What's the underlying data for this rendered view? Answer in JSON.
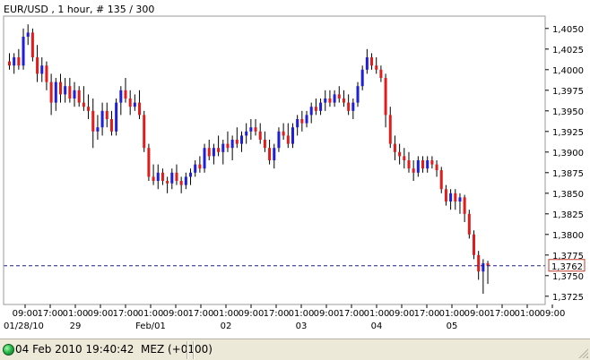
{
  "window": {
    "title": "EUR/USD , 1 hour, # 135 / 300"
  },
  "status": {
    "text": "04 Feb 2010 19:40:42  MEZ (+0100)"
  },
  "colors": {
    "up": "#1f1fd6",
    "down": "#e01d1d",
    "wick": "#000000",
    "current_line": "#1f1f8a",
    "current_box": "#c0392b"
  },
  "chart_data": {
    "type": "candlestick",
    "title": "EUR/USD , 1 hour, # 135 / 300",
    "instrument": "EUR/USD",
    "interval": "1 hour",
    "ylim": [
      1.3715,
      1.4065
    ],
    "y_ticks": [
      "1,4050",
      "1,4025",
      "1,4000",
      "1,3975",
      "1,3950",
      "1,3925",
      "1,3900",
      "1,3875",
      "1,3850",
      "1,3825",
      "1,3800",
      "1,3775",
      "1,3750",
      "1,3725"
    ],
    "y_tick_values": [
      1.405,
      1.4025,
      1.4,
      1.3975,
      1.395,
      1.3925,
      1.39,
      1.3875,
      1.385,
      1.3825,
      1.38,
      1.3775,
      1.375,
      1.3725
    ],
    "current_price": 1.3762,
    "current_price_label": "1,3762",
    "x_time_ticks": [
      "09:00",
      "17:00",
      "01:00",
      "09:00",
      "17:00",
      "01:00",
      "09:00",
      "17:00",
      "01:00",
      "09:00",
      "17:00",
      "01:00",
      "09:00",
      "17:00",
      "01:00",
      "09:00",
      "17:00",
      "01:00",
      "09:00",
      "17:00",
      "01:00",
      "09:00"
    ],
    "x_date_ticks": [
      {
        "label": "01/28/10",
        "tick_index": 0
      },
      {
        "label": "29",
        "tick_index": 2
      },
      {
        "label": "Feb/01",
        "tick_index": 5
      },
      {
        "label": "02",
        "tick_index": 8
      },
      {
        "label": "03",
        "tick_index": 11
      },
      {
        "label": "04",
        "tick_index": 14
      },
      {
        "label": "05",
        "tick_index": 17
      }
    ],
    "candles": [
      [
        1.401,
        1.402,
        1.4,
        1.4005
      ],
      [
        1.4005,
        1.402,
        1.3995,
        1.4015
      ],
      [
        1.4015,
        1.4025,
        1.4,
        1.4005
      ],
      [
        1.4005,
        1.405,
        1.4,
        1.404
      ],
      [
        1.404,
        1.4055,
        1.403,
        1.4045
      ],
      [
        1.4045,
        1.405,
        1.401,
        1.4015
      ],
      [
        1.4015,
        1.403,
        1.3985,
        1.3995
      ],
      [
        1.3995,
        1.4015,
        1.3985,
        1.4005
      ],
      [
        1.4005,
        1.401,
        1.3975,
        1.3985
      ],
      [
        1.3985,
        1.3995,
        1.3945,
        1.396
      ],
      [
        1.396,
        1.399,
        1.395,
        1.3985
      ],
      [
        1.3985,
        1.3995,
        1.396,
        1.397
      ],
      [
        1.397,
        1.399,
        1.396,
        1.398
      ],
      [
        1.398,
        1.399,
        1.396,
        1.3965
      ],
      [
        1.3965,
        1.3985,
        1.3955,
        1.3975
      ],
      [
        1.3975,
        1.398,
        1.3955,
        1.396
      ],
      [
        1.396,
        1.398,
        1.395,
        1.3955
      ],
      [
        1.3955,
        1.397,
        1.394,
        1.395
      ],
      [
        1.395,
        1.3965,
        1.3905,
        1.3925
      ],
      [
        1.3925,
        1.3945,
        1.3915,
        1.393
      ],
      [
        1.393,
        1.396,
        1.392,
        1.395
      ],
      [
        1.395,
        1.396,
        1.393,
        1.394
      ],
      [
        1.394,
        1.395,
        1.392,
        1.3925
      ],
      [
        1.3925,
        1.3965,
        1.392,
        1.396
      ],
      [
        1.396,
        1.398,
        1.3945,
        1.3975
      ],
      [
        1.3975,
        1.399,
        1.396,
        1.3965
      ],
      [
        1.3965,
        1.3975,
        1.3945,
        1.3955
      ],
      [
        1.3955,
        1.397,
        1.395,
        1.396
      ],
      [
        1.396,
        1.3975,
        1.394,
        1.3945
      ],
      [
        1.3945,
        1.395,
        1.39,
        1.3905
      ],
      [
        1.3905,
        1.391,
        1.3865,
        1.387
      ],
      [
        1.387,
        1.3885,
        1.386,
        1.3865
      ],
      [
        1.3865,
        1.3885,
        1.3855,
        1.3875
      ],
      [
        1.3875,
        1.388,
        1.386,
        1.3865
      ],
      [
        1.3865,
        1.387,
        1.385,
        1.3862
      ],
      [
        1.3862,
        1.388,
        1.3855,
        1.3875
      ],
      [
        1.3875,
        1.3885,
        1.386,
        1.3865
      ],
      [
        1.3865,
        1.387,
        1.385,
        1.386
      ],
      [
        1.386,
        1.3875,
        1.3855,
        1.387
      ],
      [
        1.387,
        1.388,
        1.386,
        1.3875
      ],
      [
        1.3875,
        1.389,
        1.387,
        1.3885
      ],
      [
        1.3885,
        1.3895,
        1.3875,
        1.388
      ],
      [
        1.388,
        1.391,
        1.3875,
        1.3905
      ],
      [
        1.3905,
        1.3915,
        1.389,
        1.3895
      ],
      [
        1.3895,
        1.391,
        1.3885,
        1.3905
      ],
      [
        1.3905,
        1.392,
        1.3895,
        1.39
      ],
      [
        1.39,
        1.3915,
        1.3885,
        1.391
      ],
      [
        1.391,
        1.3925,
        1.39,
        1.3905
      ],
      [
        1.3905,
        1.392,
        1.389,
        1.3915
      ],
      [
        1.3915,
        1.393,
        1.3905,
        1.391
      ],
      [
        1.391,
        1.3925,
        1.39,
        1.392
      ],
      [
        1.392,
        1.3935,
        1.391,
        1.3925
      ],
      [
        1.3925,
        1.394,
        1.3915,
        1.393
      ],
      [
        1.393,
        1.394,
        1.392,
        1.3925
      ],
      [
        1.3925,
        1.3935,
        1.391,
        1.3915
      ],
      [
        1.3915,
        1.3925,
        1.39,
        1.3905
      ],
      [
        1.3905,
        1.3915,
        1.3885,
        1.389
      ],
      [
        1.389,
        1.391,
        1.388,
        1.3905
      ],
      [
        1.3905,
        1.393,
        1.39,
        1.3925
      ],
      [
        1.3925,
        1.3935,
        1.3915,
        1.392
      ],
      [
        1.392,
        1.3935,
        1.3905,
        1.391
      ],
      [
        1.391,
        1.3935,
        1.3905,
        1.393
      ],
      [
        1.393,
        1.3945,
        1.392,
        1.394
      ],
      [
        1.394,
        1.395,
        1.3925,
        1.3935
      ],
      [
        1.3935,
        1.395,
        1.393,
        1.3945
      ],
      [
        1.3945,
        1.396,
        1.3935,
        1.3955
      ],
      [
        1.3955,
        1.3965,
        1.3945,
        1.395
      ],
      [
        1.395,
        1.3965,
        1.3945,
        1.396
      ],
      [
        1.396,
        1.3975,
        1.395,
        1.3965
      ],
      [
        1.3965,
        1.3975,
        1.3955,
        1.396
      ],
      [
        1.396,
        1.3975,
        1.3955,
        1.397
      ],
      [
        1.397,
        1.398,
        1.396,
        1.3965
      ],
      [
        1.3965,
        1.3975,
        1.3955,
        1.396
      ],
      [
        1.396,
        1.397,
        1.3945,
        1.395
      ],
      [
        1.395,
        1.3965,
        1.394,
        1.396
      ],
      [
        1.396,
        1.3985,
        1.3955,
        1.398
      ],
      [
        1.398,
        1.4005,
        1.3975,
        1.4
      ],
      [
        1.4,
        1.4025,
        1.3995,
        1.4015
      ],
      [
        1.4015,
        1.402,
        1.4,
        1.4005
      ],
      [
        1.4005,
        1.4015,
        1.3995,
        1.4
      ],
      [
        1.4,
        1.4005,
        1.3985,
        1.399
      ],
      [
        1.399,
        1.3995,
        1.393,
        1.3945
      ],
      [
        1.3945,
        1.3955,
        1.3905,
        1.391
      ],
      [
        1.391,
        1.392,
        1.389,
        1.39
      ],
      [
        1.39,
        1.391,
        1.3885,
        1.3895
      ],
      [
        1.3895,
        1.3905,
        1.388,
        1.389
      ],
      [
        1.389,
        1.39,
        1.3875,
        1.388
      ],
      [
        1.388,
        1.389,
        1.3865,
        1.3875
      ],
      [
        1.3875,
        1.3895,
        1.387,
        1.389
      ],
      [
        1.389,
        1.3895,
        1.3875,
        1.388
      ],
      [
        1.388,
        1.3895,
        1.3875,
        1.389
      ],
      [
        1.389,
        1.3895,
        1.388,
        1.3885
      ],
      [
        1.3885,
        1.389,
        1.387,
        1.3878
      ],
      [
        1.3878,
        1.3882,
        1.385,
        1.3855
      ],
      [
        1.3855,
        1.386,
        1.3835,
        1.384
      ],
      [
        1.384,
        1.3855,
        1.383,
        1.385
      ],
      [
        1.385,
        1.3855,
        1.383,
        1.384
      ],
      [
        1.384,
        1.385,
        1.3825,
        1.3845
      ],
      [
        1.3845,
        1.3848,
        1.3815,
        1.3825
      ],
      [
        1.3825,
        1.383,
        1.3795,
        1.38
      ],
      [
        1.38,
        1.3805,
        1.377,
        1.3775
      ],
      [
        1.3775,
        1.378,
        1.3745,
        1.3755
      ],
      [
        1.3755,
        1.377,
        1.3728,
        1.3765
      ],
      [
        1.3765,
        1.3768,
        1.374,
        1.3762
      ]
    ]
  }
}
